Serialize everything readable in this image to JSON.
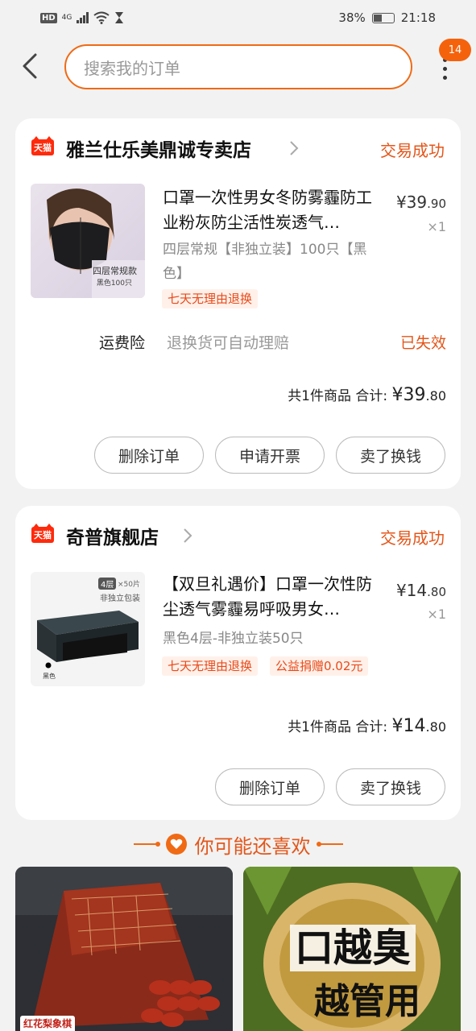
{
  "status_bar": {
    "hd": "HD",
    "network": "4G",
    "battery": "38%",
    "time": "21:18"
  },
  "search": {
    "placeholder": "搜索我的订单",
    "notification_count": "14"
  },
  "orders": [
    {
      "shop_name": "雅兰仕乐美鼎诚专卖店",
      "shop_badge": "天猫",
      "status": "交易成功",
      "item": {
        "title": "口罩一次性男女冬防雾霾防工业粉灰防尘活性炭透气…",
        "sku": "四层常规【非独立装】100只【黑色】",
        "price_main": "¥39",
        "price_decimal": ".90",
        "qty": "×1",
        "tags": [
          "七天无理由退换"
        ],
        "thumb_caption_1": "四层常规款",
        "thumb_caption_2": "黑色100只"
      },
      "insurance": {
        "label": "运费险",
        "desc": "退换货可自动理赔",
        "status": "已失效"
      },
      "total_prefix": "共1件商品 合计: ",
      "total_main": "¥39",
      "total_decimal": ".80",
      "buttons": [
        "删除订单",
        "申请开票",
        "卖了换钱"
      ]
    },
    {
      "shop_name": "奇普旗舰店",
      "shop_badge": "天猫",
      "status": "交易成功",
      "item": {
        "title": "【双旦礼遇价】口罩一次性防尘透气雾霾易呼吸男女…",
        "sku": "黑色4层-非独立装50只",
        "price_main": "¥14",
        "price_decimal": ".80",
        "qty": "×1",
        "tags": [
          "七天无理由退换",
          "公益捐赠0.02元"
        ],
        "thumb_caption_1": "4层",
        "thumb_caption_2": "×50片",
        "thumb_caption_3": "非独立包装",
        "thumb_caption_4": "黑色"
      },
      "total_prefix": "共1件商品 合计: ",
      "total_main": "¥14",
      "total_decimal": ".80",
      "buttons": [
        "删除订单",
        "卖了换钱"
      ]
    }
  ],
  "recommend": {
    "title": "你可能还喜欢",
    "items": [
      {
        "label": "红花梨象棋"
      },
      {
        "label_line1": "口越臭",
        "label_line2": "越管用"
      }
    ]
  },
  "colors": {
    "accent": "#f06a14",
    "status": "#e3561a",
    "tmall": "#ff2a0c"
  }
}
